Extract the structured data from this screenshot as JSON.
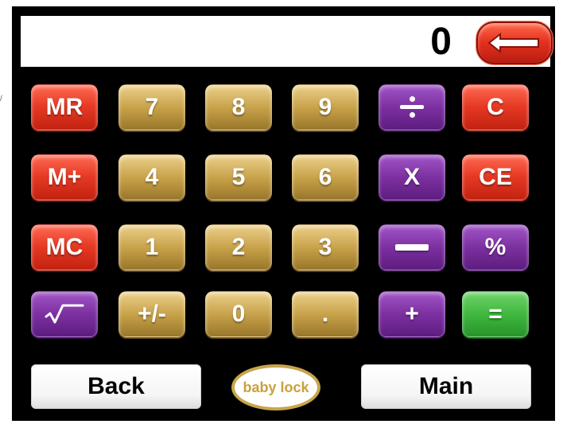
{
  "display": {
    "value": "0"
  },
  "buttons": {
    "mr": "MR",
    "mplus": "M+",
    "mc": "MC",
    "seven": "7",
    "eight": "8",
    "nine": "9",
    "four": "4",
    "five": "5",
    "six": "6",
    "one": "1",
    "two": "2",
    "three": "3",
    "plus_minus": "+/-",
    "zero": "0",
    "decimal": ".",
    "clear": "C",
    "clear_entry": "CE",
    "multiply": "X",
    "percent": "%",
    "plus": "+",
    "equals": "="
  },
  "footer": {
    "back": "Back",
    "main": "Main",
    "logo_text": "baby lock"
  },
  "icons": {
    "backspace": "backspace-arrow-icon",
    "divide": "divide-icon",
    "minus": "minus-icon",
    "sqrt": "square-root-icon"
  },
  "colors": {
    "background": "#000000",
    "display": "#ffffff",
    "memory_buttons": "#e63924",
    "digit_buttons": "#c7a149",
    "operator_buttons": "#7b2f9f",
    "equals_button": "#3fb63e",
    "logo_gold": "#c8a54a"
  }
}
